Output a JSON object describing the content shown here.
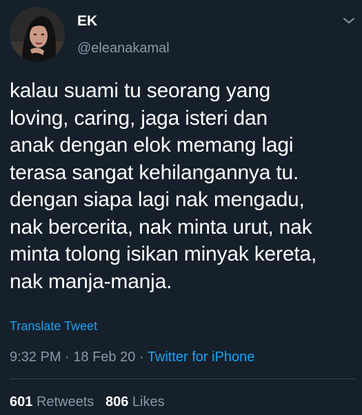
{
  "author": {
    "name": "EK",
    "handle": "@eleanakamal"
  },
  "tweet": {
    "lines": [
      "kalau suami tu seorang yang",
      "loving, caring, jaga isteri dan",
      "anak dengan elok memang lagi",
      "terasa sangat kehilangannya tu.",
      "dengan siapa lagi nak mengadu,",
      "nak bercerita, nak minta urut, nak",
      "minta tolong isikan minyak kereta,",
      "nak manja-manja."
    ],
    "translate_label": "Translate Tweet"
  },
  "meta": {
    "time": "9:32 PM",
    "separator": "·",
    "date": "18 Feb 20",
    "source": "Twitter for iPhone"
  },
  "stats": {
    "retweets_count": "601",
    "retweets_label": "Retweets",
    "likes_count": "806",
    "likes_label": "Likes"
  },
  "colors": {
    "background": "#15202b",
    "text": "#ffffff",
    "secondary": "#8899a6",
    "accent": "#1da1f2",
    "divider": "#38444d"
  },
  "icons": {
    "more_menu": "chevron-down-icon"
  }
}
